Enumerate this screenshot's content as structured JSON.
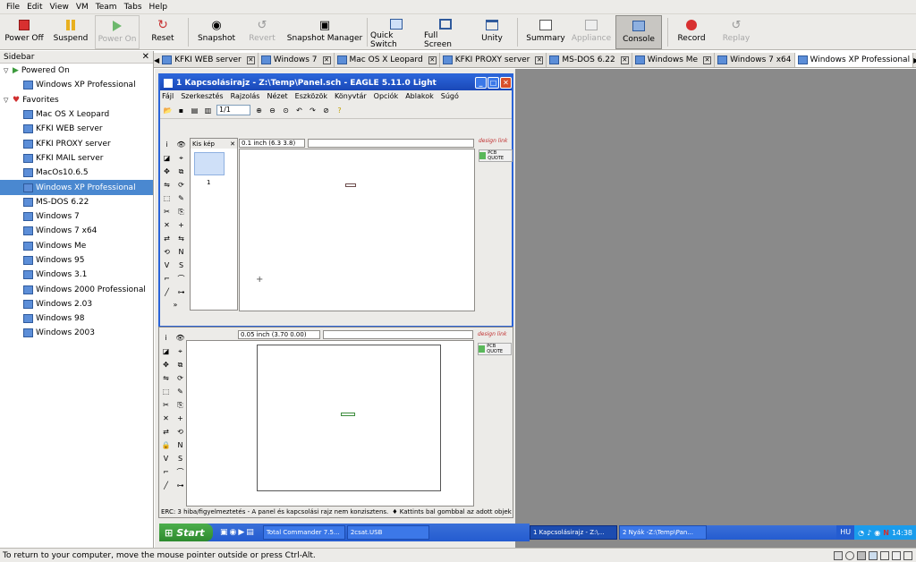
{
  "menu": [
    "File",
    "Edit",
    "View",
    "VM",
    "Team",
    "Tabs",
    "Help"
  ],
  "toolbar": {
    "power_off": "Power Off",
    "suspend": "Suspend",
    "power_on": "Power On",
    "reset": "Reset",
    "snapshot": "Snapshot",
    "revert": "Revert",
    "snapshot_manager": "Snapshot Manager",
    "quick_switch": "Quick Switch",
    "full_screen": "Full Screen",
    "unity": "Unity",
    "summary": "Summary",
    "appliance": "Appliance",
    "console": "Console",
    "record": "Record",
    "replay": "Replay"
  },
  "sidebar": {
    "title": "Sidebar",
    "powered_on_label": "Powered On",
    "powered_on": [
      "Windows XP Professional"
    ],
    "favorites_label": "Favorites",
    "favorites": [
      "Mac OS X Leopard",
      "KFKI WEB server",
      "KFKI PROXY server",
      "KFKI MAIL server",
      "MacOs10.6.5",
      "Windows XP Professional",
      "MS-DOS 6.22",
      "Windows 7",
      "Windows 7 x64",
      "Windows Me",
      "Windows 95",
      "Windows 3.1",
      "Windows 2000 Professional",
      "Windows 2.03",
      "Windows 98",
      "Windows 2003"
    ]
  },
  "tabs": [
    "KFKI WEB server",
    "Windows 7",
    "Mac OS X Leopard",
    "KFKI PROXY server",
    "MS-DOS 6.22",
    "Windows Me",
    "Windows 7 x64",
    "Windows XP Professional"
  ],
  "eagle1": {
    "title": "1 Kapcsolásirajz - Z:\\Temp\\Panel.sch - EAGLE 5.11.0 Light",
    "menu": [
      "Fájl",
      "Szerkesztés",
      "Rajzolás",
      "Nézet",
      "Eszközök",
      "Könyvtár",
      "Opciók",
      "Ablakok",
      "Súgó"
    ],
    "zoom_value": "1/1",
    "coords": "0.1 inch (6.3 3.8)",
    "thumb_tab": "Kis kép",
    "page_num": "1",
    "logo": "design link",
    "pcb": "PCB QUOTE"
  },
  "eagle2": {
    "coords": "0.05 inch (3.70 0.00)",
    "erc_text": "ERC: 3 hiba/figyelmeztetés - A panel és kapcsolási rajz nem konzisztens.",
    "hint_text": "♦ Kattints bal gombbal az adott objektum mozgi",
    "logo": "design link",
    "pcb": "PCB QUOTE"
  },
  "taskbar": {
    "start": "Start",
    "items": [
      "Total Commander 7.5...",
      "2csat.USB",
      "1 Kapcsolásirajz - Z:\\...",
      "2 Nyák -Z:\\Temp\\Pan..."
    ],
    "lang": "HU",
    "clock": "14:38"
  },
  "status": "To return to your computer, move the mouse pointer outside or press Ctrl-Alt.",
  "colors": {
    "accent": "#4a88d0",
    "xp_blue": "#2b64d8",
    "start_green": "#3c9a3c"
  }
}
